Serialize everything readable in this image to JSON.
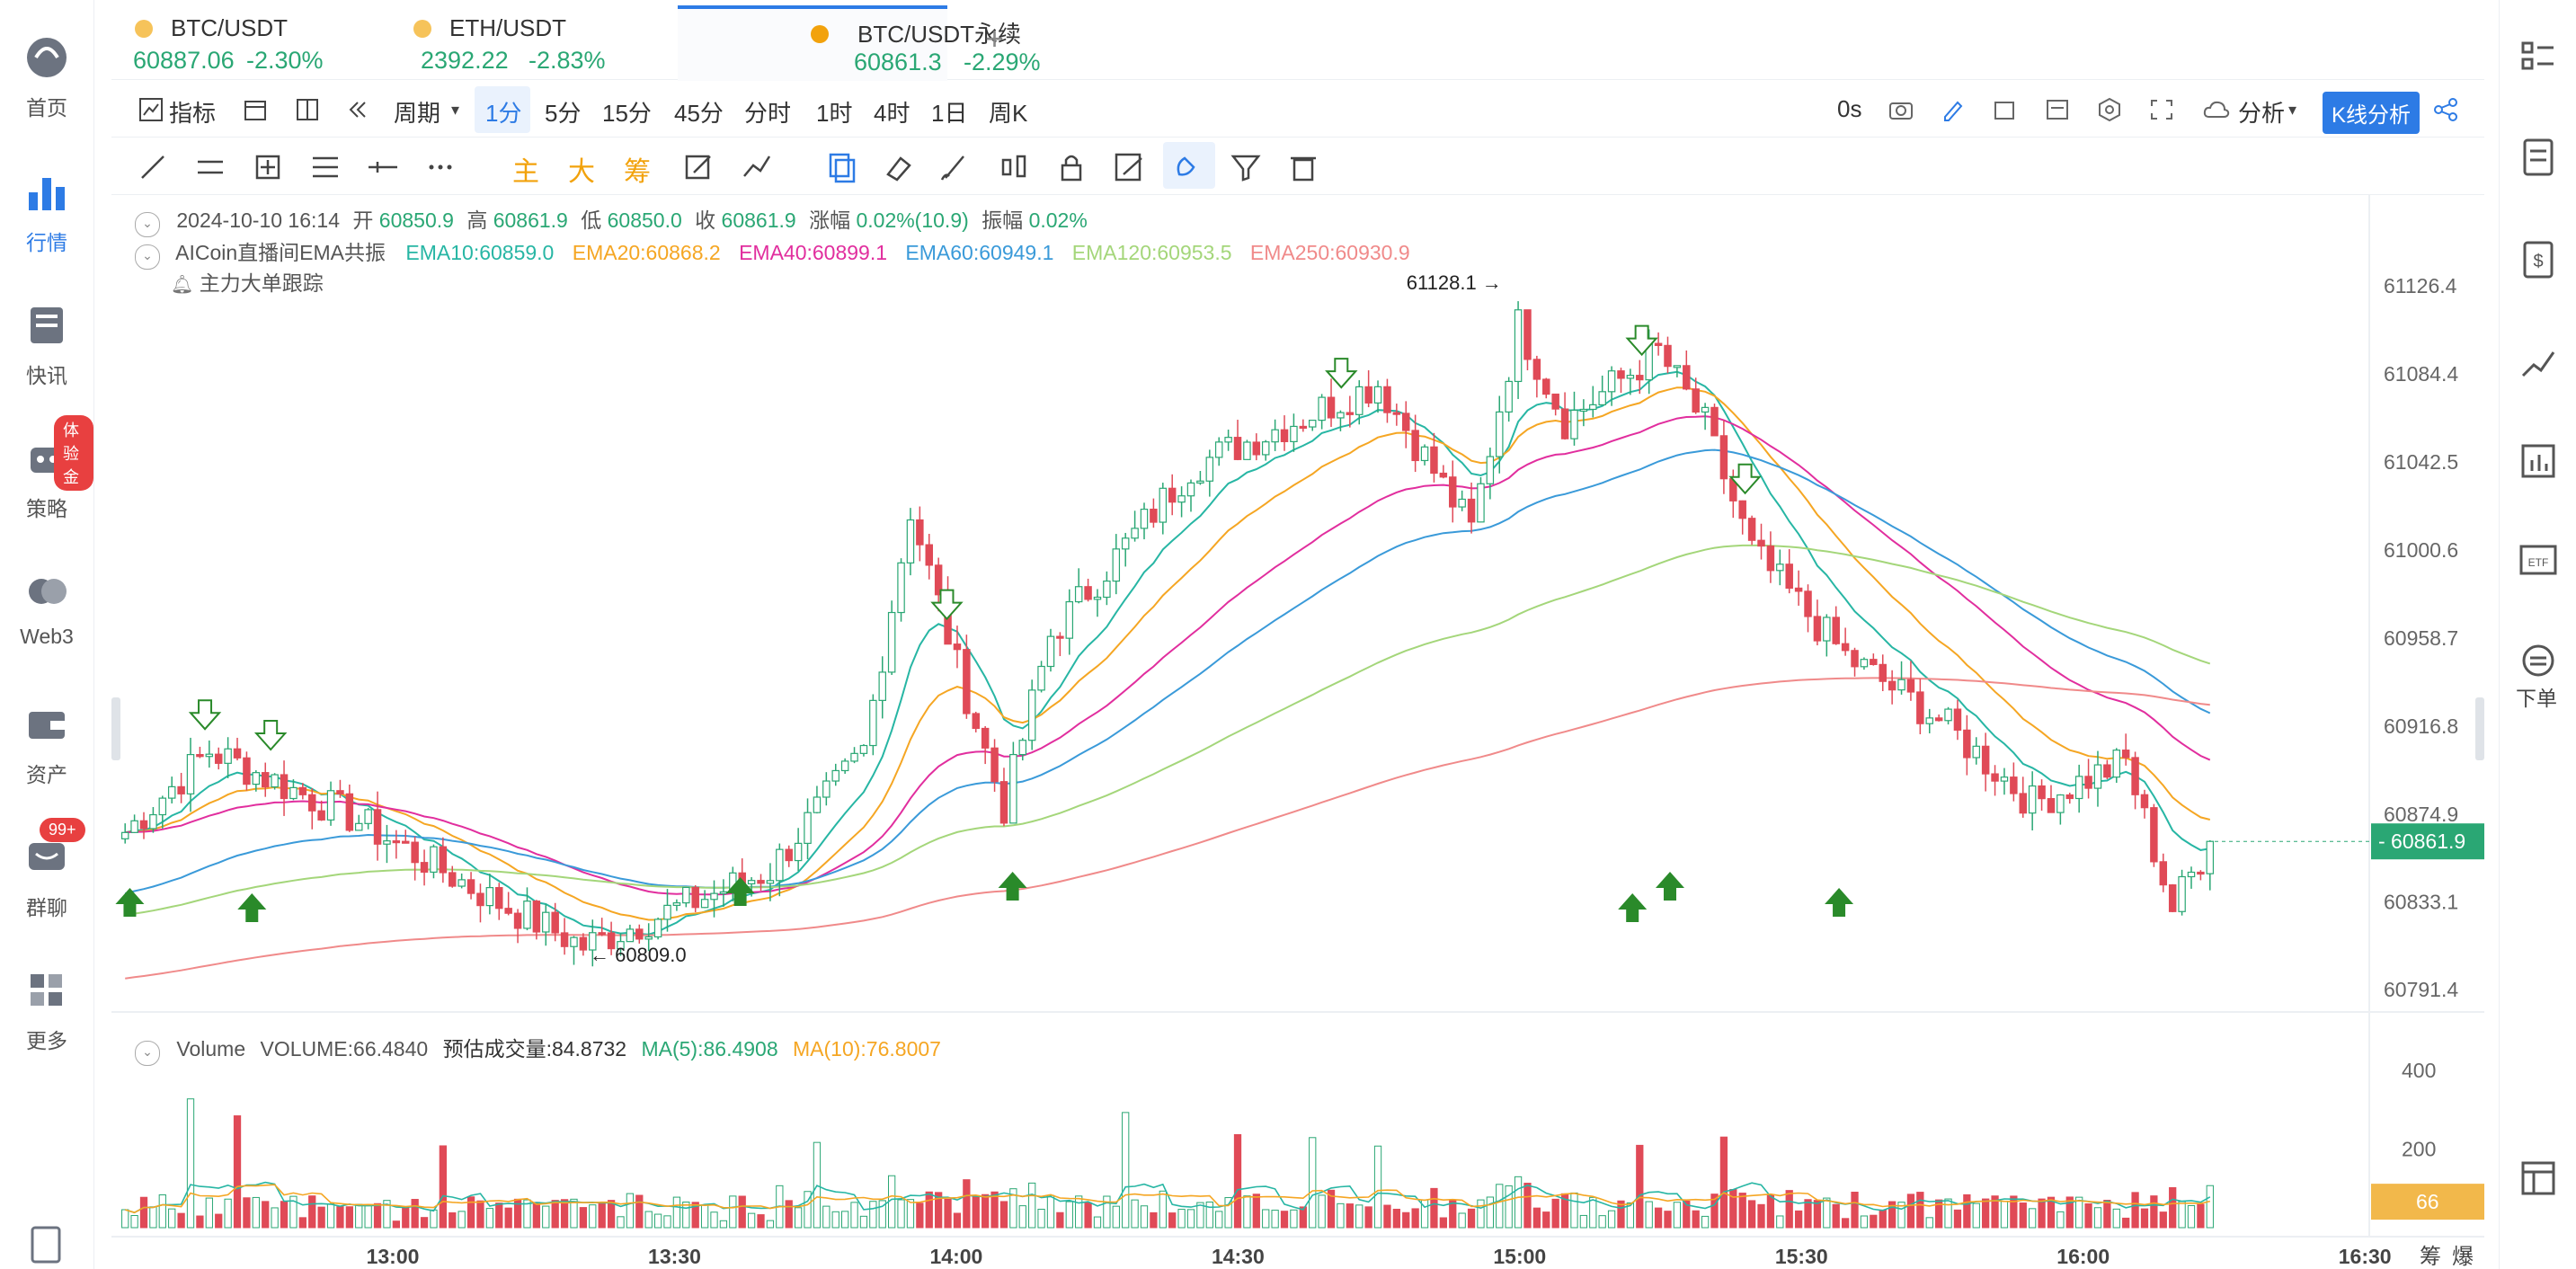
{
  "left_nav": [
    {
      "label": "首页",
      "icon": "home-icon"
    },
    {
      "label": "行情",
      "icon": "market-chart-icon"
    },
    {
      "label": "快讯",
      "icon": "news-icon"
    },
    {
      "label": "策略",
      "icon": "robot-icon",
      "badge": "体验金"
    },
    {
      "label": "Web3",
      "icon": "web3-icon"
    },
    {
      "label": "资产",
      "icon": "wallet-icon"
    },
    {
      "label": "群聊",
      "icon": "chat-icon",
      "badge": "99+"
    },
    {
      "label": "更多",
      "icon": "grid-icon"
    }
  ],
  "right_nav": {
    "order_label": "下单"
  },
  "tabs": [
    {
      "name": "BTC/USDT",
      "price": "60887.06",
      "change": "-2.30%"
    },
    {
      "name": "ETH/USDT",
      "price": "2392.22",
      "change": "-2.83%"
    },
    {
      "name": "BTC/USDT永续",
      "price": "60861.3",
      "change": "-2.29%"
    }
  ],
  "toolbar": {
    "indicator": "指标",
    "period": "周期",
    "intervals": [
      "1分",
      "5分",
      "15分",
      "45分",
      "分时",
      "1时",
      "4时",
      "1日",
      "周K"
    ],
    "active_interval": "1分",
    "countdown": "0s",
    "analysis": "分析",
    "kline_analysis": "K线分析"
  },
  "drawing_tools": [
    "主",
    "大",
    "筹"
  ],
  "ohlc": {
    "datetime": "2024-10-10 16:14",
    "open_label": "开",
    "open": "60850.9",
    "high_label": "高",
    "high": "60861.9",
    "low_label": "低",
    "low": "60850.0",
    "close_label": "收",
    "close": "60861.9",
    "change_label": "涨幅",
    "change": "0.02%(10.9)",
    "amp_label": "振幅",
    "amp": "0.02%"
  },
  "ema_line": {
    "name": "AICoin直播间EMA共振",
    "ema10": "EMA10:60859.0",
    "ema20": "EMA20:60868.2",
    "ema40": "EMA40:60899.1",
    "ema60": "EMA60:60949.1",
    "ema120": "EMA120:60953.5",
    "ema250": "EMA250:60930.9"
  },
  "big_order": "主力大单跟踪",
  "volume_line": {
    "name": "Volume",
    "volume": "VOLUME:66.4840",
    "estimated": "预估成交量:84.8732",
    "ma5": "MA(5):86.4908",
    "ma10": "MA(10):76.8007"
  },
  "colors": {
    "up": "#2aa774",
    "down": "#e04a57",
    "ema10": "#27b6a4",
    "ema20": "#f5a623",
    "ema40": "#e12e9e",
    "ema60": "#3a9ad9",
    "ema120": "#a4d67a",
    "ema250": "#f08a8a",
    "accent": "#2d7be5"
  },
  "chart_data": {
    "type": "candlestick",
    "price_ticks": [
      "61126.4",
      "61084.4",
      "61042.5",
      "61000.6",
      "60958.7",
      "60916.8",
      "60874.9",
      "60833.1",
      "60791.4"
    ],
    "current_price": "60861.9",
    "volume_ticks": [
      "400",
      "200"
    ],
    "current_volume": "66",
    "x_ticks": [
      "13:00",
      "13:30",
      "14:00",
      "14:30",
      "15:00",
      "15:30",
      "16:00",
      "16:30"
    ],
    "high_marker": "61128.1",
    "low_marker": "60809.0",
    "bottom_right_labels": [
      "筹",
      "爆"
    ],
    "ylim": [
      60791.4,
      61126.4
    ],
    "key_closes": [
      {
        "time": "12:30",
        "close": 60862
      },
      {
        "time": "12:40",
        "close": 60905
      },
      {
        "time": "12:55",
        "close": 60874
      },
      {
        "time": "13:10",
        "close": 60835
      },
      {
        "time": "13:20",
        "close": 60812
      },
      {
        "time": "13:40",
        "close": 60848
      },
      {
        "time": "13:50",
        "close": 60905
      },
      {
        "time": "13:55",
        "close": 61020
      },
      {
        "time": "14:00",
        "close": 60945
      },
      {
        "time": "14:05",
        "close": 60878
      },
      {
        "time": "14:10",
        "close": 60960
      },
      {
        "time": "14:25",
        "close": 61040
      },
      {
        "time": "14:45",
        "close": 61080
      },
      {
        "time": "14:55",
        "close": 61010
      },
      {
        "time": "15:00",
        "close": 61108
      },
      {
        "time": "15:05",
        "close": 61062
      },
      {
        "time": "15:15",
        "close": 61095
      },
      {
        "time": "15:20",
        "close": 61060
      },
      {
        "time": "15:25",
        "close": 61000
      },
      {
        "time": "15:35",
        "close": 60950
      },
      {
        "time": "15:45",
        "close": 60920
      },
      {
        "time": "15:55",
        "close": 60880
      },
      {
        "time": "16:05",
        "close": 60900
      },
      {
        "time": "16:10",
        "close": 60830
      },
      {
        "time": "16:14",
        "close": 60862
      }
    ]
  }
}
